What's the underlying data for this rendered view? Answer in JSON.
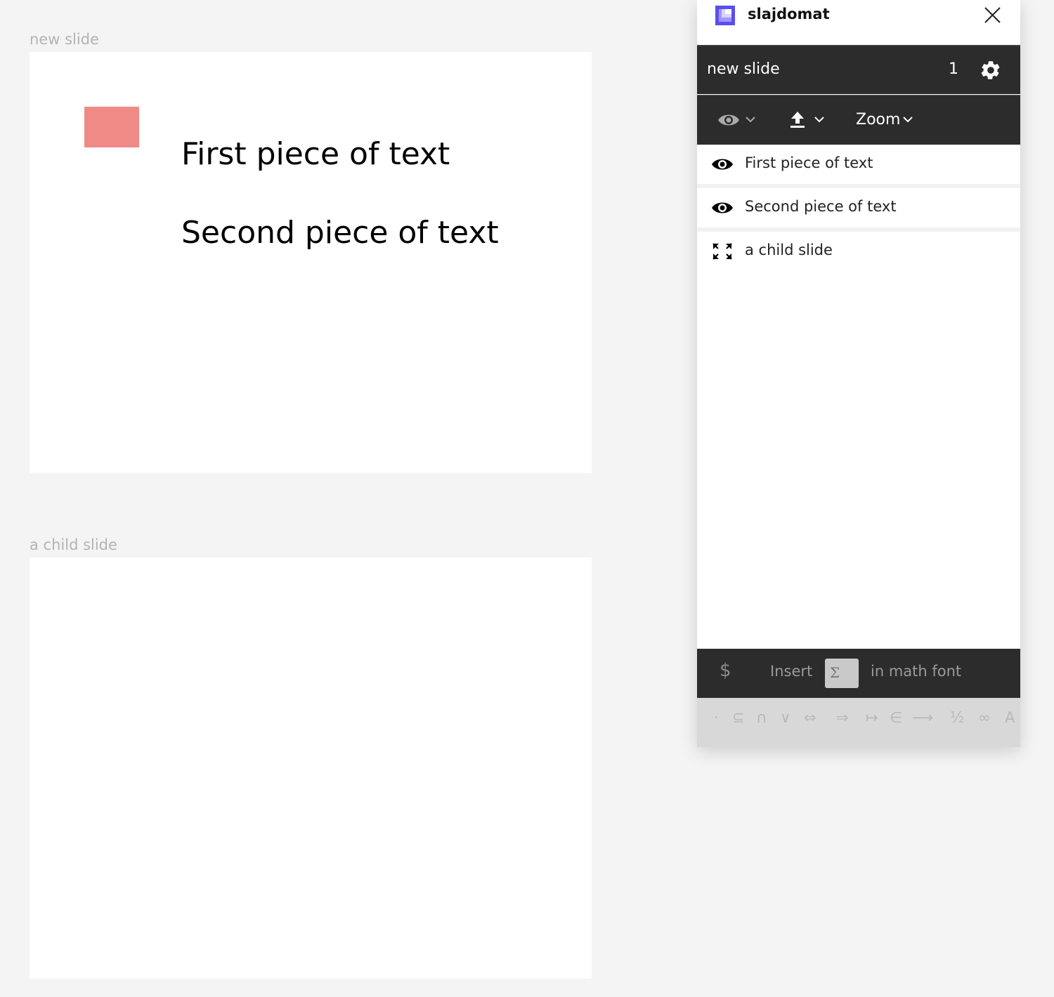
{
  "canvas": {
    "frames": [
      {
        "label": "new slide",
        "texts": [
          "First piece of text",
          "Second piece of text"
        ],
        "shape_color": "#f08a86"
      },
      {
        "label": "a child slide"
      }
    ]
  },
  "panel": {
    "app_title": "slajdomat",
    "logo_color": "#5b4ef0",
    "slide_name": "new slide",
    "slide_number": "1",
    "toolbar": {
      "visibility_icon": "eye-icon",
      "export_icon": "upload-icon",
      "zoom_label": "Zoom"
    },
    "items": [
      {
        "icon": "eye-icon",
        "label": "First piece of text"
      },
      {
        "icon": "eye-icon",
        "label": "Second piece of text"
      },
      {
        "icon": "expand-icon",
        "label": "a child slide"
      }
    ],
    "math": {
      "dollar": "$",
      "insert_label": "Insert",
      "sigma": "Σ",
      "suffix_label": "in math font"
    },
    "symbols": [
      "·",
      "⊆",
      "∩",
      "∨",
      "⇔",
      "⇒",
      "↦",
      "∈",
      "⟶",
      "½",
      "∞",
      "A"
    ]
  },
  "colors": {
    "panel_dark": "#2c2c2c",
    "canvas_bg": "#f4f4f4"
  }
}
